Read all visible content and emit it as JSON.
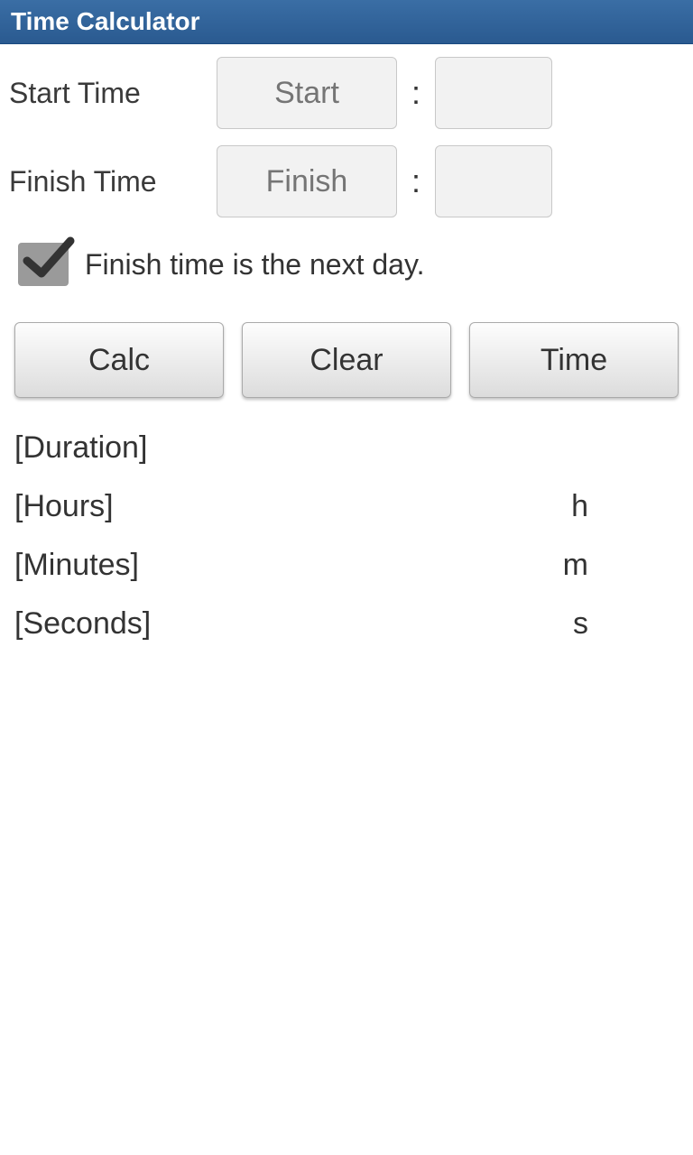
{
  "title": "Time Calculator",
  "startTime": {
    "label": "Start Time",
    "placeholder": "Start"
  },
  "finishTime": {
    "label": "Finish Time",
    "placeholder": "Finish"
  },
  "nextDay": {
    "label": "Finish time is the next day.",
    "checked": true
  },
  "buttons": {
    "calc": "Calc",
    "clear": "Clear",
    "time": "Time"
  },
  "results": {
    "duration": "[Duration]",
    "hours": {
      "label": "[Hours]",
      "unit": "h"
    },
    "minutes": {
      "label": "[Minutes]",
      "unit": "m"
    },
    "seconds": {
      "label": "[Seconds]",
      "unit": "s"
    }
  }
}
